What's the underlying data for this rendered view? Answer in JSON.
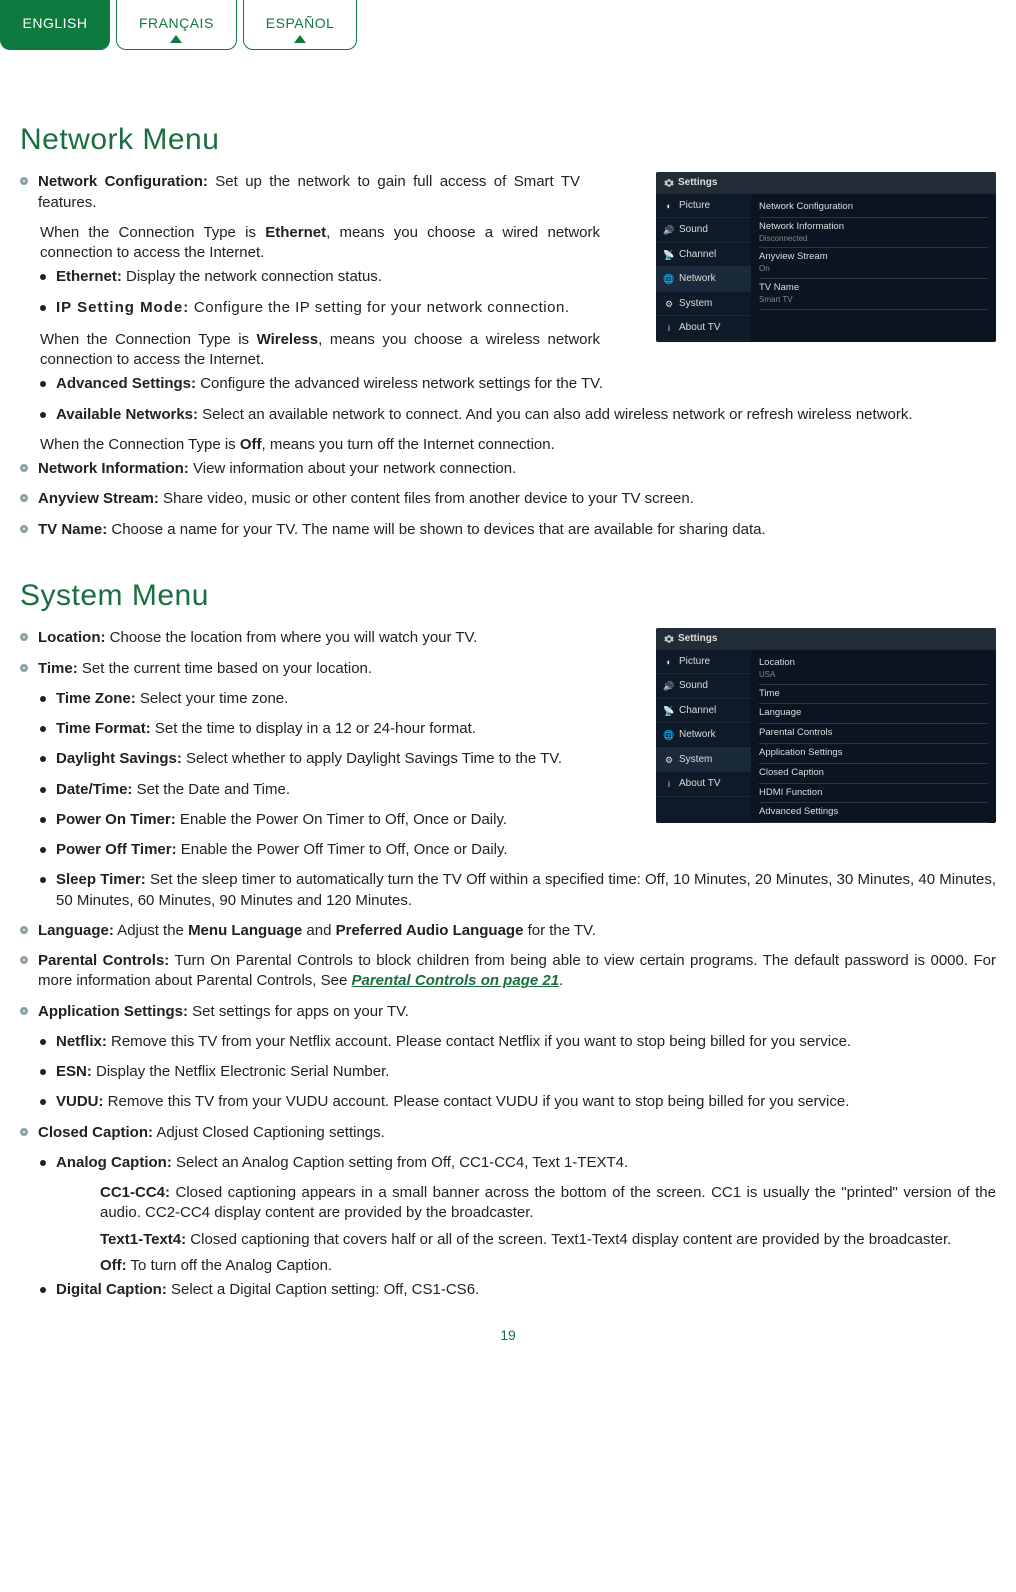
{
  "lang_tabs": {
    "english": "ENGLISH",
    "francais": "FRANÇAIS",
    "espanol": "ESPAÑOL"
  },
  "sections": {
    "network": {
      "title": "Network Menu",
      "items": {
        "net_config_label": "Network Configuration:",
        "net_config_text": " Set up the network to gain full access of Smart TV features.",
        "ethernet_intro_a": "When the Connection Type is ",
        "ethernet_b": "Ethernet",
        "ethernet_intro_c": ", means you choose a wired network connection to access the Internet.",
        "ethernet_label": "Ethernet:",
        "ethernet_text": " Display the network connection status.",
        "ip_label": "IP Setting Mode:",
        "ip_text": " Configure the IP setting for your network connection.",
        "wireless_intro_a": "When the Connection Type is ",
        "wireless_b": "Wireless",
        "wireless_intro_c": ", means you choose a wireless network connection to access the Internet.",
        "adv_label": "Advanced Settings:",
        "adv_text": " Configure the advanced wireless network settings for the TV.",
        "avail_label": "Available Networks:",
        "avail_text": " Select an available network to connect. And you can also add wireless network or refresh wireless network.",
        "off_intro_a": "When the Connection Type is ",
        "off_b": "Off",
        "off_intro_c": ", means you turn off the Internet connection.",
        "netinfo_label": "Network Information:",
        "netinfo_text": " View information about your network connection.",
        "anyview_label": "Anyview Stream:",
        "anyview_text": " Share video, music or other content files from another device to your TV screen.",
        "tvname_label": "TV Name:",
        "tvname_text": " Choose a name for your TV. The name will be shown to devices that are available for sharing data."
      }
    },
    "system": {
      "title": "System Menu",
      "items": {
        "location_label": "Location:",
        "location_text": " Choose the location from where you will watch your TV.",
        "time_label": "Time:",
        "time_text": " Set the current time based on your location.",
        "tz_label": "Time Zone:",
        "tz_text": " Select your time zone.",
        "tf_label": "Time Format:",
        "tf_text": " Set the time to display in a 12 or 24-hour format.",
        "ds_label": "Daylight Savings:",
        "ds_text": " Select whether to apply Daylight Savings Time to the TV.",
        "dt_label": "Date/Time:",
        "dt_text": " Set the Date and Time.",
        "pon_label": "Power On Timer:",
        "pon_text": " Enable the Power On Timer to Off, Once or Daily.",
        "poff_label": "Power Off Timer:",
        "poff_text": " Enable the Power Off Timer to Off, Once or Daily.",
        "sleep_label": "Sleep Timer:",
        "sleep_text": " Set the sleep timer to automatically turn the TV Off within a specified time: Off, 10 Minutes, 20 Minutes, 30 Minutes, 40 Minutes, 50 Minutes, 60 Minutes, 90 Minutes and 120 Minutes.",
        "lang_label": "Language:",
        "lang_text_a": " Adjust the ",
        "lang_text_b": "Menu Language",
        "lang_text_c": " and ",
        "lang_text_d": "Preferred Audio Language",
        "lang_text_e": " for the TV.",
        "parental_label": "Parental Controls:",
        "parental_text_a": " Turn On Parental Controls to block children from being able to view certain programs. The default password is 0000. For more information about Parental Controls, See ",
        "parental_link": "Parental Controls on page 21",
        "parental_text_b": ".",
        "app_label": "Application Settings:",
        "app_text": " Set settings for apps on your TV.",
        "netflix_label": "Netflix:",
        "netflix_text": " Remove this TV from your Netflix account. Please contact Netflix if you want to stop being billed for you service.",
        "esn_label": "ESN:",
        "esn_text": " Display the Netflix Electronic Serial Number.",
        "vudu_label": "VUDU:",
        "vudu_text": " Remove this TV from your VUDU account. Please contact VUDU if you want to stop being billed for you service.",
        "cc_label": "Closed Caption:",
        "cc_text": " Adjust Closed Captioning settings.",
        "ana_label": "Analog Caption:",
        "ana_text": " Select an Analog Caption setting from Off, CC1-CC4, Text 1-TEXT4.",
        "cc14_label": "CC1-CC4:",
        "cc14_text": " Closed captioning appears in a small banner across the bottom of the screen. CC1 is usually the \"printed\" version of the audio. CC2-CC4 display content are provided by the broadcaster.",
        "txt14_label": "Text1-Text4:",
        "txt14_text": " Closed captioning that covers half or all of the screen. Text1-Text4 display content are provided by the broadcaster.",
        "ccoff_label": "Off:",
        "ccoff_text": " To turn off the Analog Caption.",
        "dig_label": "Digital Caption:",
        "dig_text": " Select a Digital Caption setting: Off, CS1-CS6."
      }
    }
  },
  "tv_network": {
    "header": "Settings",
    "side": [
      "Picture",
      "Sound",
      "Channel",
      "Network",
      "System",
      "About TV"
    ],
    "rows": [
      {
        "lbl": "Network Configuration",
        "sub": ""
      },
      {
        "lbl": "Network Information",
        "sub": "Disconnected"
      },
      {
        "lbl": "Anyview Stream",
        "sub": "On"
      },
      {
        "lbl": "TV Name",
        "sub": "Smart TV"
      }
    ]
  },
  "tv_system": {
    "header": "Settings",
    "side": [
      "Picture",
      "Sound",
      "Channel",
      "Network",
      "System",
      "About TV"
    ],
    "rows": [
      {
        "lbl": "Location",
        "sub": "USA"
      },
      {
        "lbl": "Time",
        "sub": ""
      },
      {
        "lbl": "Language",
        "sub": ""
      },
      {
        "lbl": "Parental Controls",
        "sub": ""
      },
      {
        "lbl": "Application Settings",
        "sub": ""
      },
      {
        "lbl": "Closed Caption",
        "sub": ""
      },
      {
        "lbl": "HDMI Function",
        "sub": ""
      },
      {
        "lbl": "Advanced Settings",
        "sub": ""
      }
    ]
  },
  "page_number": "19"
}
